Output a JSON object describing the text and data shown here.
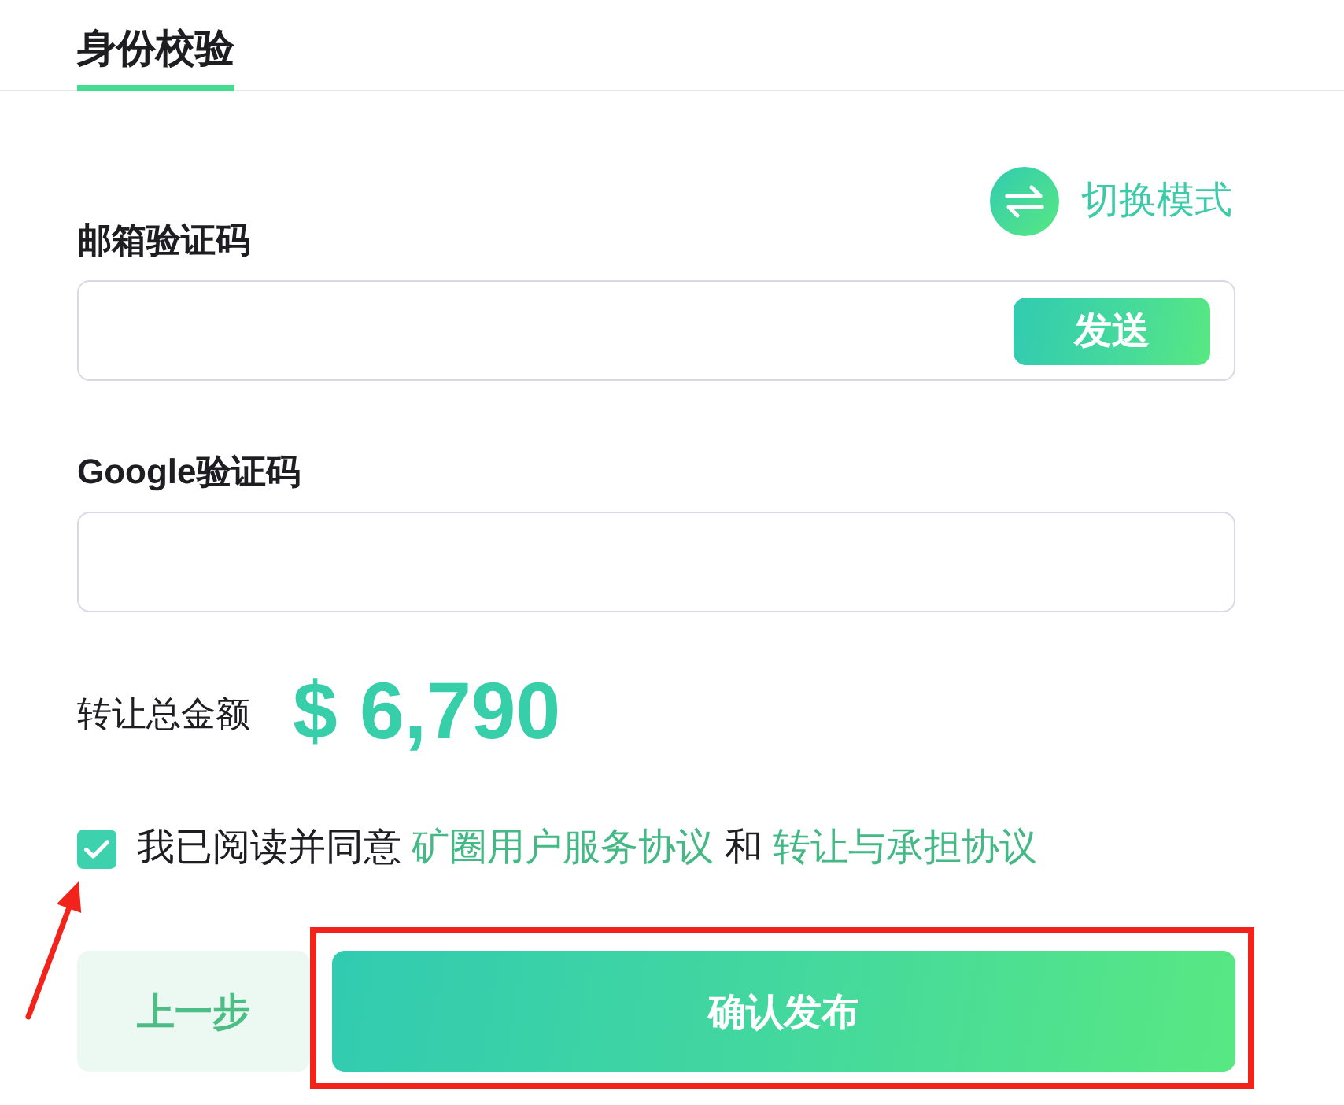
{
  "tabs": [
    {
      "label": "身份校验",
      "selected": true
    }
  ],
  "mode_switch": {
    "label": "切换模式"
  },
  "fields": [
    {
      "kind": "with-button",
      "label": "邮箱验证码",
      "button": "发送"
    },
    {
      "kind": "plain",
      "label": "Google验证码"
    }
  ],
  "total": {
    "label": "转让总金额",
    "amount": "$ 6,790"
  },
  "agreement": {
    "checked": true,
    "annotation": {
      "kind": "arrow"
    },
    "parts": [
      {
        "kind": "text",
        "text": "我已阅读并同意"
      },
      {
        "kind": "link",
        "text": "矿圈用户服务协议"
      },
      {
        "kind": "text",
        "text": "和"
      },
      {
        "kind": "link",
        "text": "转让与承担协议"
      }
    ]
  },
  "buttons": [
    {
      "kind": "secondary",
      "label": "上一步"
    },
    {
      "kind": "primary",
      "label": "确认发布",
      "annotation": {
        "kind": "frame"
      }
    }
  ]
}
